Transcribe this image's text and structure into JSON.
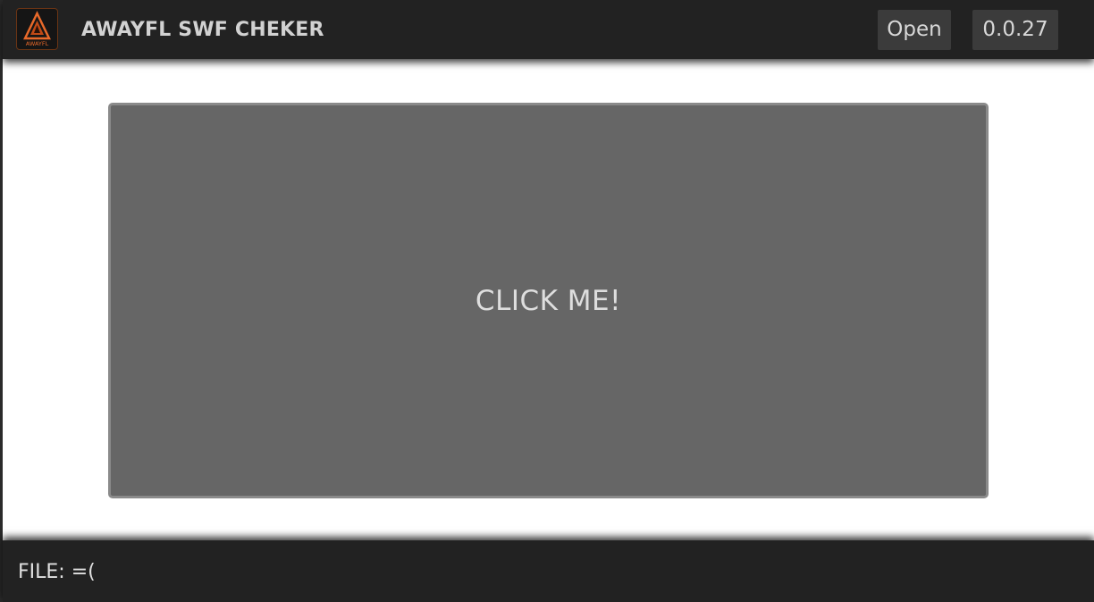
{
  "header": {
    "title": "AWAYFL SWF CHEKER",
    "logo_text": "AWAYFL",
    "open_label": "Open",
    "version_label": "0.0.27"
  },
  "main": {
    "dropzone_label": "CLICK ME!"
  },
  "footer": {
    "file_label": "FILE:",
    "file_value": "=("
  },
  "colors": {
    "header_bg": "#222222",
    "dropzone_bg": "#666666",
    "logo_accent": "#e8692a"
  }
}
